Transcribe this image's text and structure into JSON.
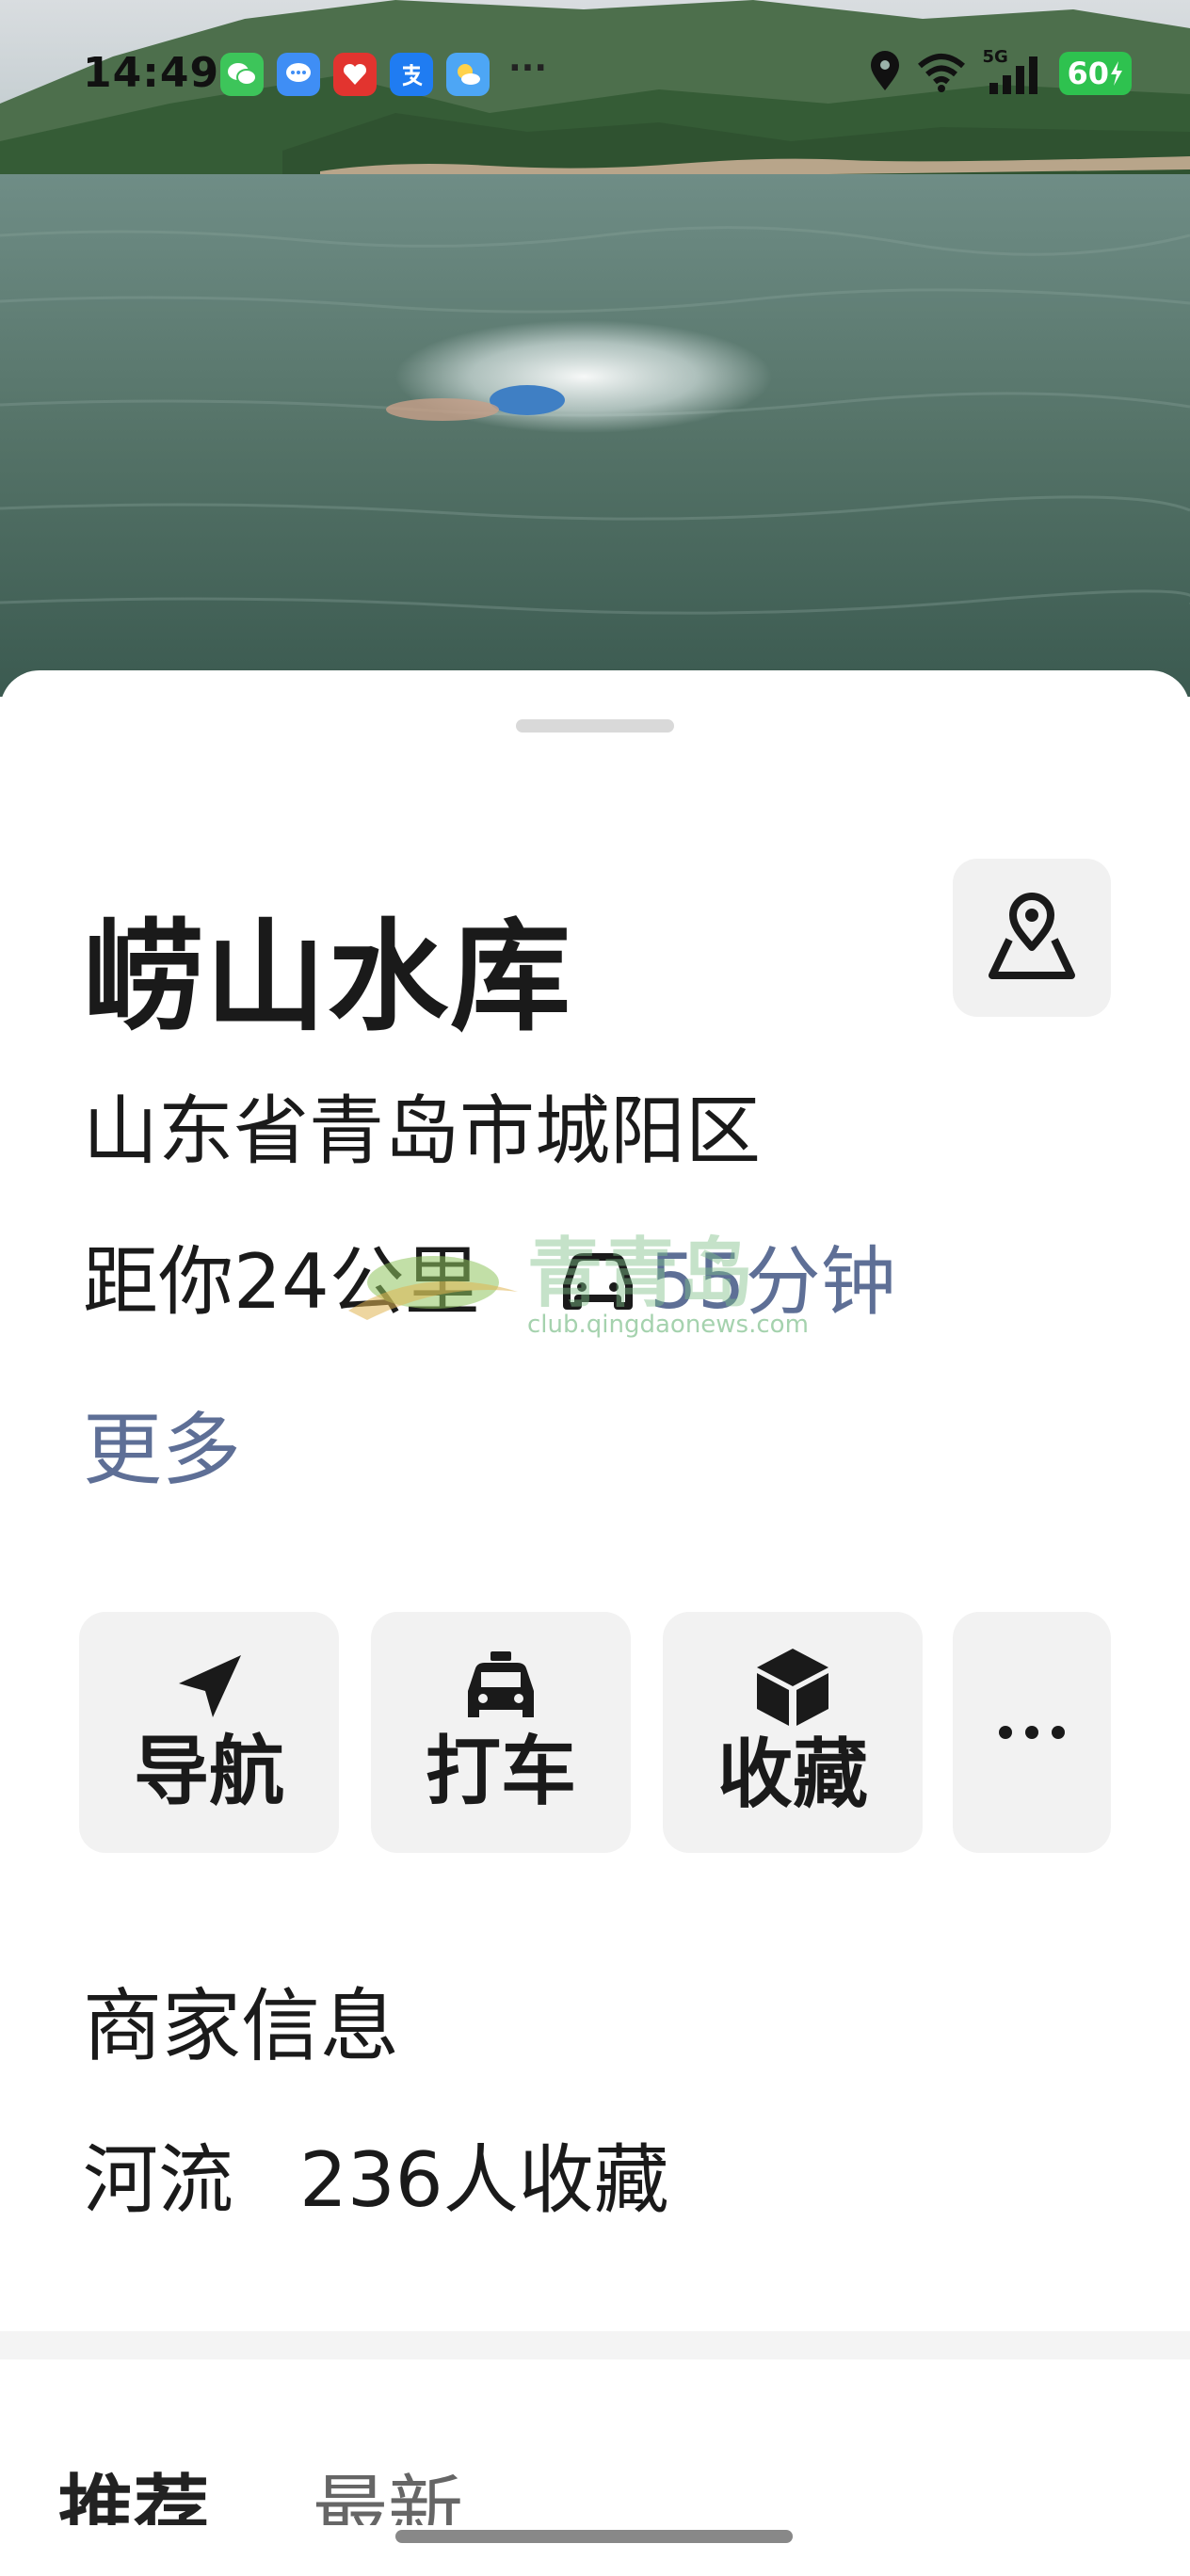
{
  "status_bar": {
    "time": "14:49",
    "notification_icons": [
      "wechat-icon",
      "message-icon",
      "red-app-icon",
      "alipay-icon",
      "weather-icon"
    ],
    "more_notifications": "···",
    "network_label": "5G",
    "battery": "60"
  },
  "place": {
    "title": "崂山水库",
    "address": "山东省青岛市城阳区",
    "distance": "距你24公里",
    "duration": "55分钟",
    "more_link": "更多"
  },
  "actions": [
    {
      "label": "导航",
      "icon": "navigate-arrow-icon"
    },
    {
      "label": "打车",
      "icon": "taxi-icon"
    },
    {
      "label": "收藏",
      "icon": "cube-icon"
    },
    {
      "label": "",
      "icon": "more-dots-icon"
    }
  ],
  "merchant": {
    "heading": "商家信息",
    "category": "河流",
    "favorites": "236人收藏"
  },
  "tabs": [
    "推荐",
    "最新"
  ],
  "watermark": {
    "logo_text": "青青岛",
    "url": "club.qingdaonews.com"
  },
  "colors": {
    "link": "#5e6f96",
    "button_bg": "#f2f2f2",
    "battery_green": "#2ec24f"
  }
}
